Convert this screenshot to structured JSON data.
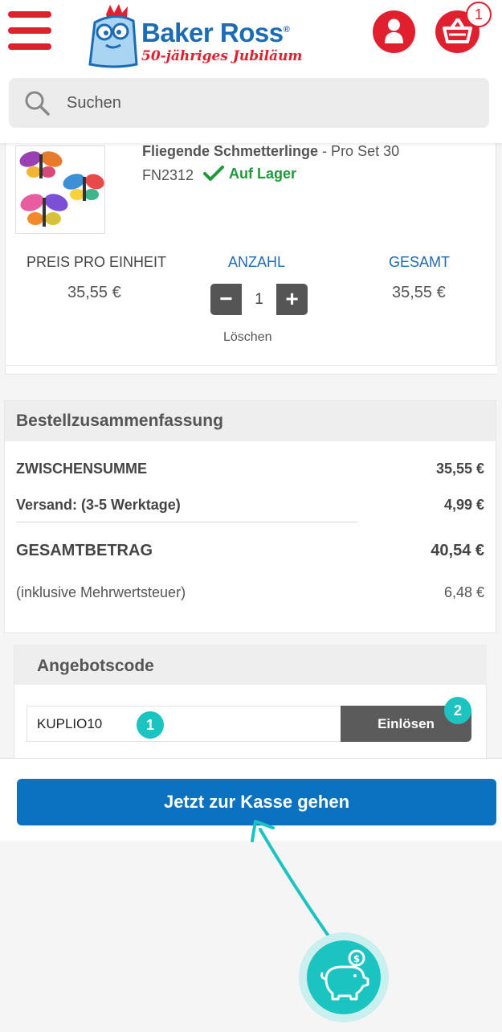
{
  "header": {
    "brand": "Baker Ross",
    "brand_mark": "®",
    "tagline": "50-jähriges Jubiläum",
    "cart_count": "1",
    "search_placeholder": "Suchen"
  },
  "product": {
    "name": "Fliegende Schmetterlinge",
    "variant": " - Pro Set 30",
    "sku": "FN2312",
    "stock": "Auf Lager",
    "columns": {
      "price": "PREIS PRO EINHEIT",
      "qty": "ANZAHL",
      "total": "GESAMT"
    },
    "unit_price": "35,55 €",
    "quantity": "1",
    "line_total": "35,55 €",
    "minus": "−",
    "plus": "+",
    "delete": "Löschen"
  },
  "summary": {
    "title": "Bestellzusammenfassung",
    "subtotal_label": "ZWISCHENSUMME",
    "subtotal_value": "35,55 €",
    "shipping_label": "Versand: (3-5 Werktage)",
    "shipping_value": "4,99 €",
    "total_label": "GESAMTBETRAG",
    "total_value": "40,54 €",
    "vat_label": "(inklusive Mehrwertsteuer)",
    "vat_value": "6,48 €"
  },
  "coupon": {
    "title": "Angebotscode",
    "code": "KUPLIO10",
    "button": "Einlösen",
    "step1": "1",
    "step2": "2"
  },
  "checkout": {
    "button": "Jetzt zur Kasse gehen"
  },
  "colors": {
    "brand_red": "#e0202e",
    "brand_blue": "#1c6bb5",
    "accent_teal": "#1bc3c1",
    "button_blue": "#0a72c0",
    "stock_green": "#1d9a3a"
  }
}
